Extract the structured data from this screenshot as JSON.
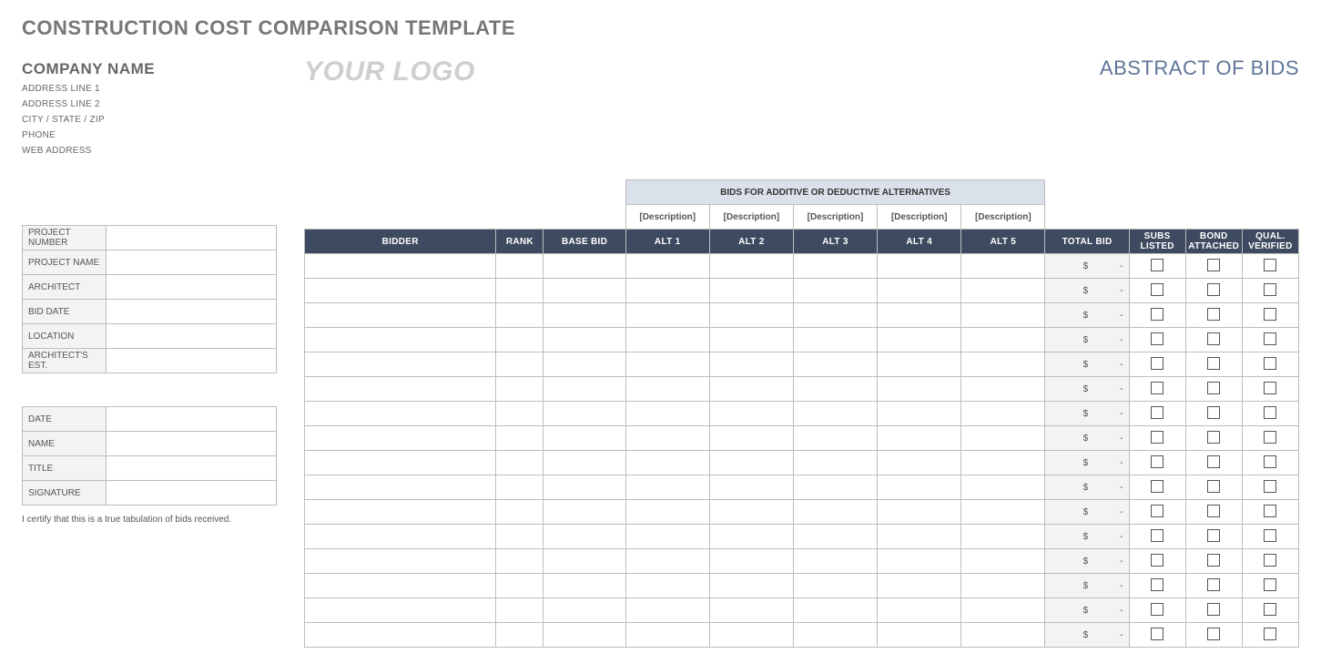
{
  "top_title": "CONSTRUCTION COST COMPARISON TEMPLATE",
  "company": {
    "name": "COMPANY NAME",
    "addr1": "ADDRESS LINE 1",
    "addr2": "ADDRESS LINE 2",
    "csz": "CITY / STATE / ZIP",
    "phone": "PHONE",
    "web": "WEB ADDRESS"
  },
  "logo_text": "YOUR LOGO",
  "abstract_title": "ABSTRACT OF BIDS",
  "project_info_labels": {
    "project_number": "PROJECT NUMBER",
    "project_name": "PROJECT NAME",
    "architect": "ARCHITECT",
    "bid_date": "BID DATE",
    "location": "LOCATION",
    "architects_est": "ARCHITECT'S EST."
  },
  "project_info_values": {
    "project_number": "",
    "project_name": "",
    "architect": "",
    "bid_date": "",
    "location": "",
    "architects_est": ""
  },
  "signature_labels": {
    "date": "DATE",
    "name": "NAME",
    "title": "TITLE",
    "signature": "SIGNATURE"
  },
  "signature_values": {
    "date": "",
    "name": "",
    "title": "",
    "signature": ""
  },
  "certify_text": "I certify that this is a true tabulation of bids received.",
  "alt_banner": "BIDS FOR ADDITIVE OR DEDUCTIVE ALTERNATIVES",
  "alt_descriptions": [
    "[Description]",
    "[Description]",
    "[Description]",
    "[Description]",
    "[Description]"
  ],
  "columns": {
    "bidder": "BIDDER",
    "rank": "RANK",
    "base_bid": "BASE BID",
    "alt1": "ALT 1",
    "alt2": "ALT 2",
    "alt3": "ALT 3",
    "alt4": "ALT 4",
    "alt5": "ALT 5",
    "total_bid": "TOTAL BID",
    "subs_listed": "SUBS LISTED",
    "bond_attached": "BOND ATTACHED",
    "qual_verified": "QUAL. VERIFIED"
  },
  "total_bid_currency": "$",
  "total_bid_value": "-",
  "row_count": 16
}
